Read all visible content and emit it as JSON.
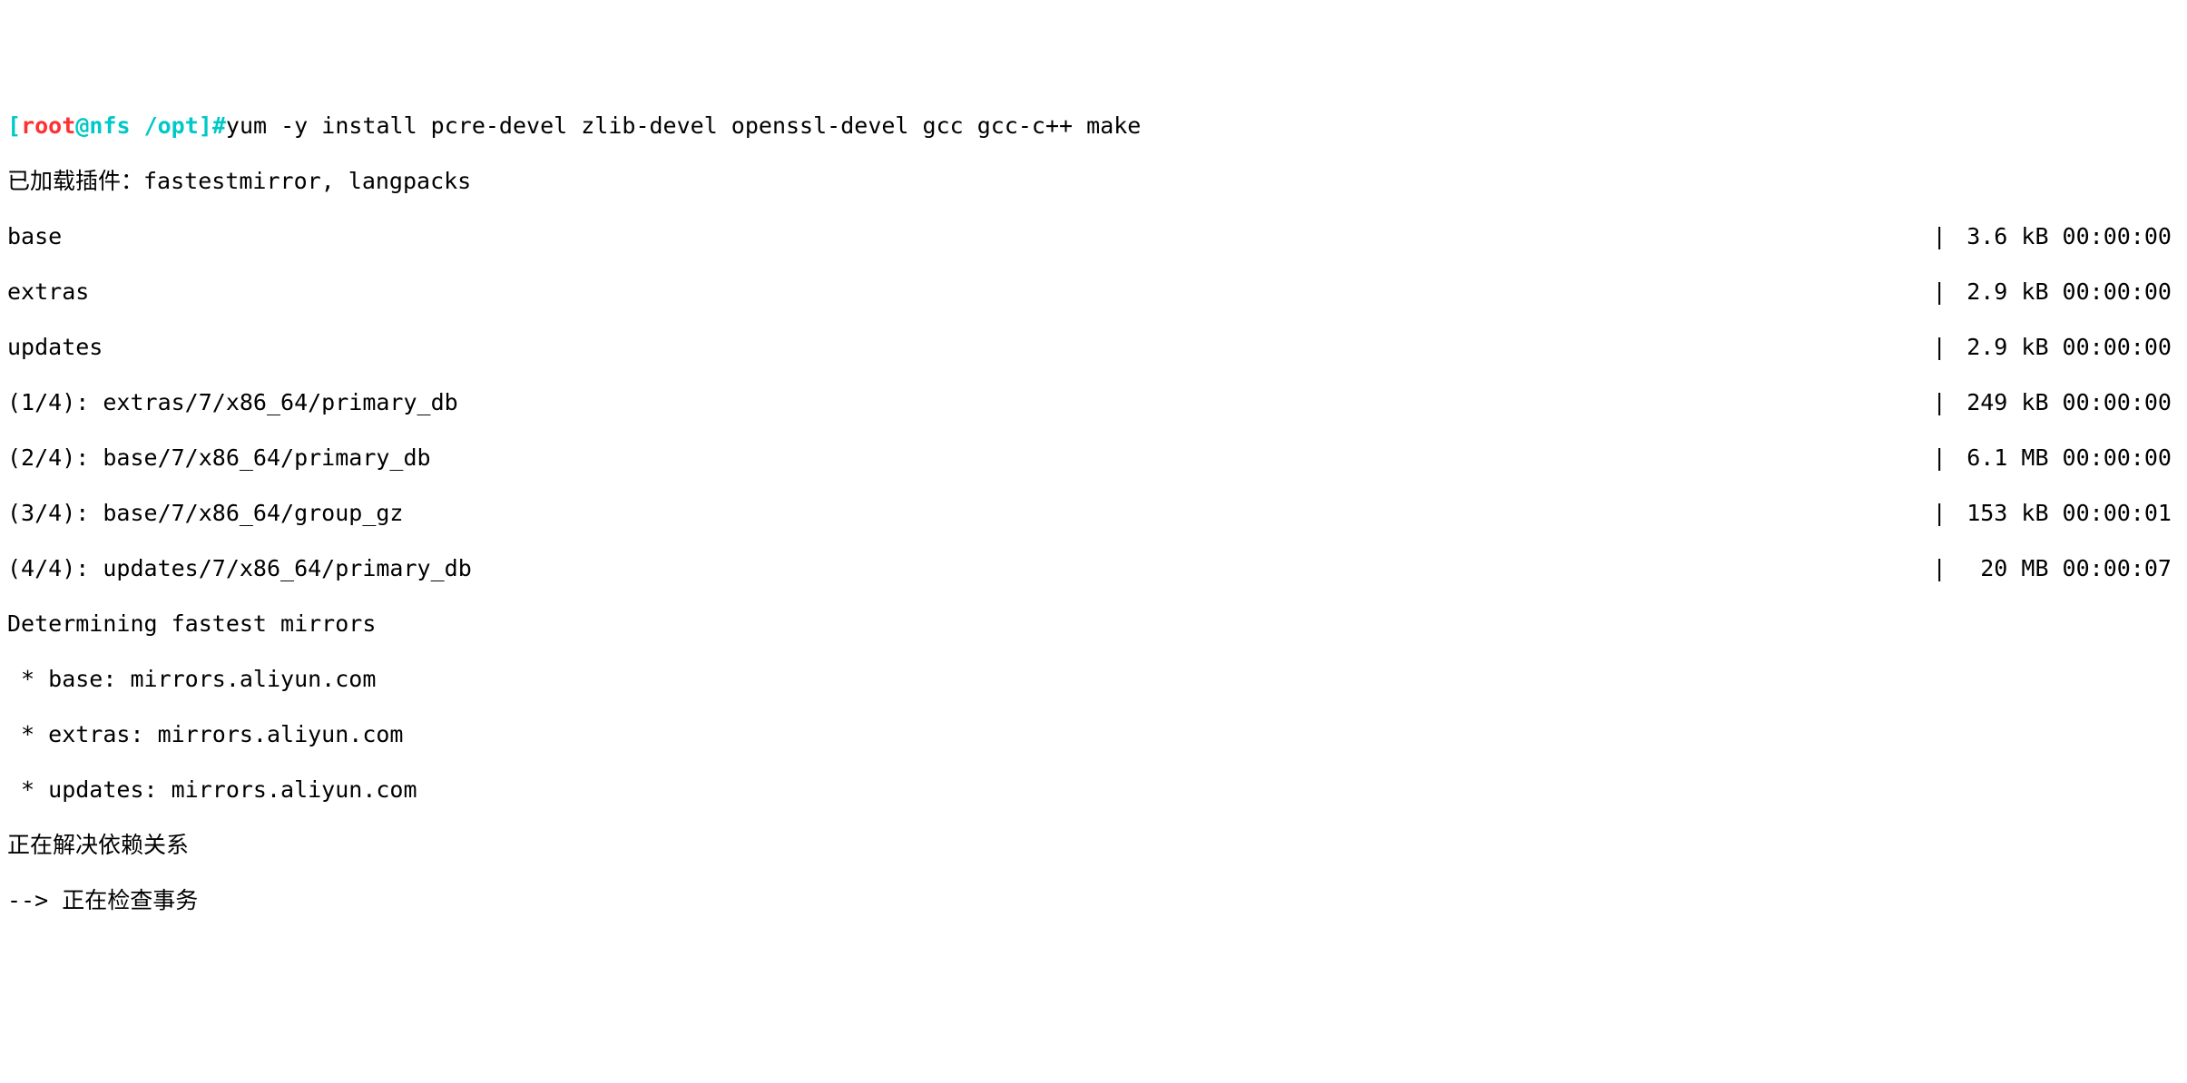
{
  "prompt": {
    "open_bracket": "[",
    "user": "root",
    "at": "@",
    "host": "nfs",
    "space1": " ",
    "cwd": "/opt",
    "close_bracket": "]",
    "hash": "#"
  },
  "command": "yum -y install pcre-devel zlib-devel openssl-devel gcc gcc-c++ make",
  "plugins_line": "已加载插件：fastestmirror, langpacks",
  "downloads": [
    {
      "left": "base",
      "sep": "|",
      "size": "3.6 kB",
      "time": "00:00:00"
    },
    {
      "left": "extras",
      "sep": "|",
      "size": "2.9 kB",
      "time": "00:00:00"
    },
    {
      "left": "updates",
      "sep": "|",
      "size": "2.9 kB",
      "time": "00:00:00"
    },
    {
      "left": "(1/4): extras/7/x86_64/primary_db",
      "sep": "|",
      "size": "249 kB",
      "time": "00:00:00"
    },
    {
      "left": "(2/4): base/7/x86_64/primary_db",
      "sep": "|",
      "size": "6.1 MB",
      "time": "00:00:00"
    },
    {
      "left": "(3/4): base/7/x86_64/group_gz",
      "sep": "|",
      "size": "153 kB",
      "time": "00:00:01"
    },
    {
      "left": "(4/4): updates/7/x86_64/primary_db",
      "sep": "|",
      "size": " 20 MB",
      "time": "00:00:07"
    }
  ],
  "determining": "Determining fastest mirrors",
  "mirrors": [
    " * base: mirrors.aliyun.com",
    " * extras: mirrors.aliyun.com",
    " * updates: mirrors.aliyun.com"
  ],
  "resolving": "正在解决依赖关系",
  "checking": "--> 正在检查事务"
}
